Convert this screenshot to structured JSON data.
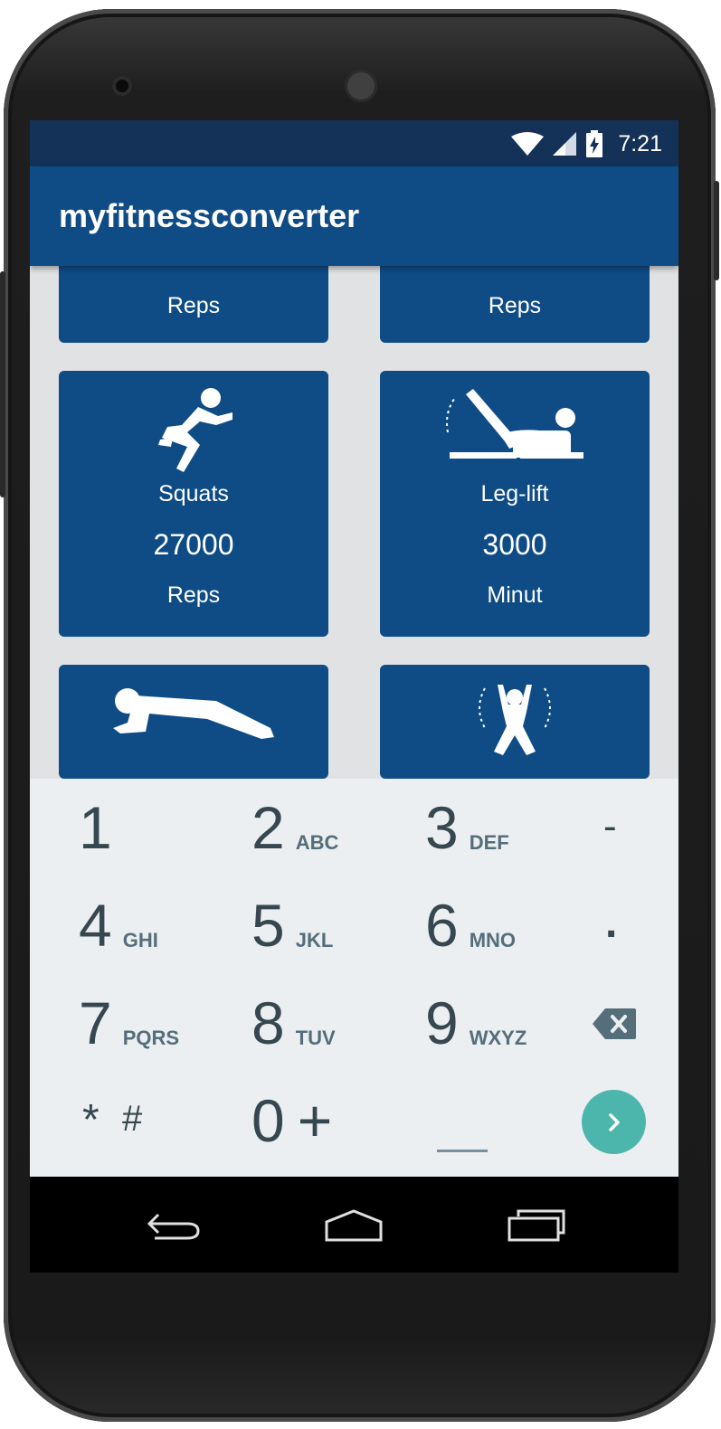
{
  "status_bar": {
    "time": "7:21",
    "icons": [
      "wifi-icon",
      "cell-signal-icon",
      "battery-charging-icon"
    ]
  },
  "app_bar": {
    "title": "myfitnessconverter"
  },
  "tiles": {
    "top_left": {
      "unit": "Reps"
    },
    "top_right": {
      "unit": "Reps"
    },
    "squats": {
      "icon": "squat-icon",
      "name": "Squats",
      "value": "27000",
      "unit": "Reps"
    },
    "leg_lift": {
      "icon": "leg-lift-icon",
      "name": "Leg-lift",
      "value": "3000",
      "unit": "Minut"
    },
    "bottom_left": {
      "icon": "plank-icon"
    },
    "bottom_right": {
      "icon": "jumping-jack-icon"
    }
  },
  "keyboard": {
    "keys": [
      {
        "digit": "1",
        "letters": ""
      },
      {
        "digit": "2",
        "letters": "ABC"
      },
      {
        "digit": "3",
        "letters": "DEF"
      },
      {
        "digit": "4",
        "letters": "GHI"
      },
      {
        "digit": "5",
        "letters": "JKL"
      },
      {
        "digit": "6",
        "letters": "MNO"
      },
      {
        "digit": "7",
        "letters": "PQRS"
      },
      {
        "digit": "8",
        "letters": "TUV"
      },
      {
        "digit": "9",
        "letters": "WXYZ"
      },
      {
        "digit": "0",
        "letters": "+"
      }
    ],
    "minus": "-",
    "dot": ".",
    "star": "*",
    "hash": "#",
    "space": "___",
    "backspace_icon": "backspace-icon",
    "go_icon": "chevron-right-icon",
    "accent": "#4db6ac"
  },
  "colors": {
    "primary": "#0f4c86",
    "status_bar": "#143158",
    "background": "#e1e2e3",
    "keyboard": "#eceff1"
  }
}
